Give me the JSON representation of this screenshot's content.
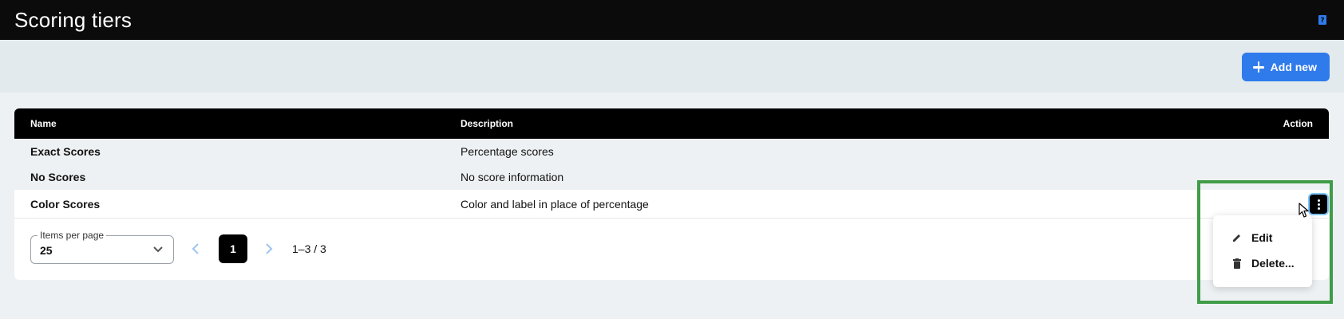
{
  "header": {
    "title": "Scoring tiers",
    "help_icon": "help-book-icon"
  },
  "toolbar": {
    "add_label": "Add new",
    "add_icon": "plus-icon",
    "accent": "#2f7bec"
  },
  "table": {
    "columns": {
      "name": "Name",
      "description": "Description",
      "action": "Action"
    },
    "rows": [
      {
        "name": "Exact Scores",
        "description": "Percentage scores"
      },
      {
        "name": "No Scores",
        "description": "No score information"
      },
      {
        "name": "Color Scores",
        "description": "Color and label in place of percentage"
      }
    ]
  },
  "pagination": {
    "items_per_page_label": "Items per page",
    "items_per_page_value": "25",
    "current_page": "1",
    "range_text": "1–3 / 3"
  },
  "row_menu": {
    "items": [
      {
        "label": "Edit",
        "icon": "pencil-icon"
      },
      {
        "label": "Delete...",
        "icon": "trash-icon"
      }
    ]
  },
  "colors": {
    "header_bg": "#0b0b0b",
    "highlight": "#3f9c47"
  }
}
